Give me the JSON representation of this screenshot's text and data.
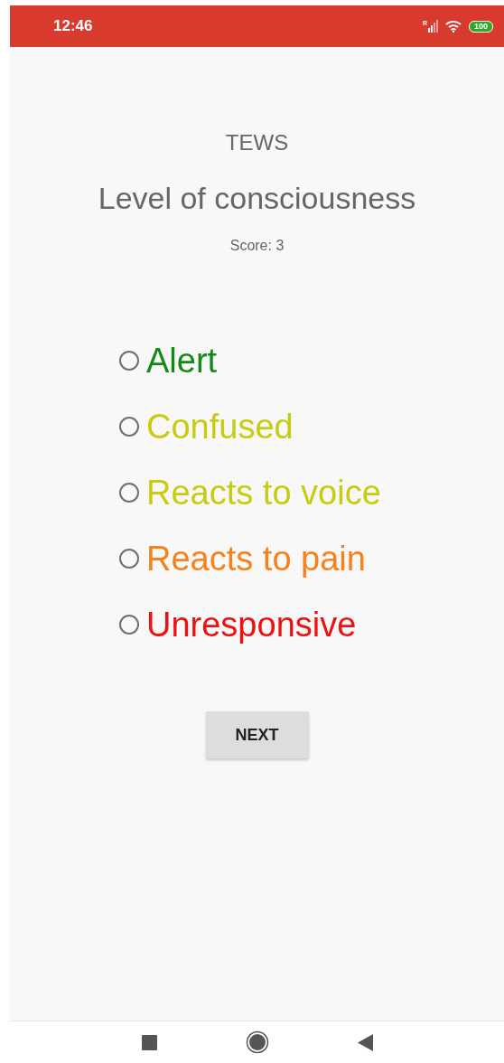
{
  "status_bar": {
    "time": "12:46",
    "signal_label": "R",
    "battery": "100"
  },
  "header": {
    "app_title": "TEWS",
    "question": "Level of consciousness",
    "score": "Score: 3"
  },
  "options": [
    {
      "label": "Alert",
      "color": "#138a13",
      "selected": false
    },
    {
      "label": "Confused",
      "color": "#c8cc10",
      "selected": false
    },
    {
      "label": "Reacts to voice",
      "color": "#c8cc10",
      "selected": false
    },
    {
      "label": "Reacts to pain",
      "color": "#f7821b",
      "selected": false
    },
    {
      "label": "Unresponsive",
      "color": "#ee1111",
      "selected": false
    }
  ],
  "next_button": {
    "label": "NEXT"
  }
}
